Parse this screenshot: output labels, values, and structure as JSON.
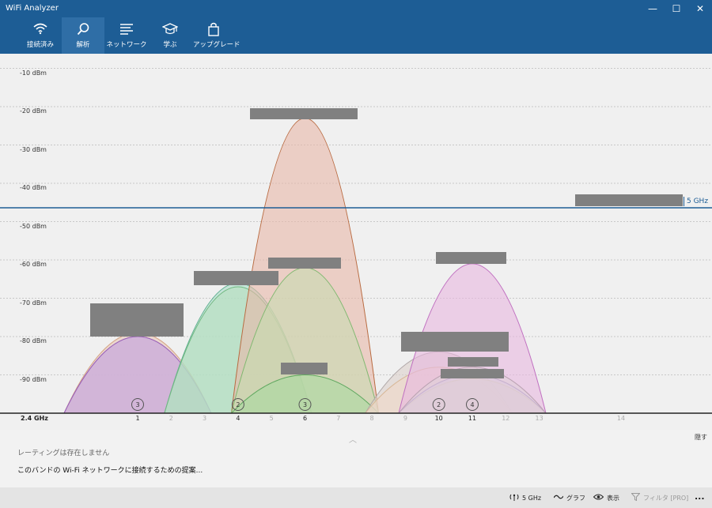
{
  "window": {
    "title": "WiFi Analyzer",
    "controls": {
      "minimize": "—",
      "maximize": "☐",
      "close": "✕"
    }
  },
  "tabs": [
    {
      "label": "接続済み",
      "icon": "wifi-icon",
      "active": false
    },
    {
      "label": "解析",
      "icon": "search-icon",
      "active": true
    },
    {
      "label": "ネットワーク",
      "icon": "list-icon",
      "active": false
    },
    {
      "label": "学ぶ",
      "icon": "graduation-cap-icon",
      "active": false
    },
    {
      "label": "アップグレード",
      "icon": "shopping-bag-icon",
      "active": false
    }
  ],
  "chart": {
    "y_ticks": [
      "-10 dBm",
      "-20 dBm",
      "-30 dBm",
      "-40 dBm",
      "-50 dBm",
      "-60 dBm",
      "-70 dBm",
      "-80 dBm",
      "-90 dBm"
    ],
    "band_label": "2.4 GHz",
    "x_ticks": [
      "1",
      "2",
      "3",
      "4",
      "5",
      "6",
      "7",
      "8",
      "9",
      "10",
      "11",
      "12",
      "13",
      "14"
    ],
    "highlighted_channels": [
      "1",
      "4",
      "6",
      "10",
      "11"
    ],
    "reference_line_label": "5 GHz",
    "reference_line_dbm": -45,
    "channel_badges": [
      {
        "channel": 1,
        "count": "3"
      },
      {
        "channel": 4,
        "count": "2"
      },
      {
        "channel": 6,
        "count": "3"
      },
      {
        "channel": 10,
        "count": "2"
      },
      {
        "channel": 11,
        "count": "4"
      }
    ]
  },
  "chart_data": {
    "type": "area",
    "xlabel": "",
    "ylabel": "",
    "ylim": [
      -100,
      -5
    ],
    "series": [
      {
        "channel": 1,
        "peak_dbm": -79,
        "fill": "#e8c8b8",
        "stroke": "#d4a080"
      },
      {
        "channel": 1,
        "peak_dbm": -80,
        "fill": "#d8c0e0",
        "stroke": "#b090c0"
      },
      {
        "channel": 1,
        "peak_dbm": -80,
        "fill": "#c8a8d8",
        "stroke": "#9a60b8"
      },
      {
        "channel": 4,
        "peak_dbm": -66,
        "fill": "#a8dcc8",
        "stroke": "#60b090"
      },
      {
        "channel": 4,
        "peak_dbm": -67,
        "fill": "#b8e0c0",
        "stroke": "#70b880"
      },
      {
        "channel": 6,
        "peak_dbm": -23,
        "fill": "#e8b8a8",
        "stroke": "#b86a40"
      },
      {
        "channel": 6,
        "peak_dbm": -62,
        "fill": "#c8dcb0",
        "stroke": "#80b870"
      },
      {
        "channel": 6,
        "peak_dbm": -90,
        "fill": "#a8d8a0",
        "stroke": "#60a860"
      },
      {
        "channel": 10,
        "peak_dbm": -84,
        "fill": "#dcd0cc",
        "stroke": "#b0a8a8"
      },
      {
        "channel": 10,
        "peak_dbm": -88,
        "fill": "#f0d8c8",
        "stroke": "#d8b898"
      },
      {
        "channel": 11,
        "peak_dbm": -61,
        "fill": "#e8b8e0",
        "stroke": "#c070c0"
      },
      {
        "channel": 11,
        "peak_dbm": -91,
        "fill": "#f0e0b8",
        "stroke": "#d8c080"
      },
      {
        "channel": 11,
        "peak_dbm": -90,
        "fill": "#d8c0e8",
        "stroke": "#a080c0"
      },
      {
        "channel": 11,
        "peak_dbm": -88,
        "fill": "#e0d0d8",
        "stroke": "#b8a0b0"
      }
    ],
    "grid": true
  },
  "panel": {
    "no_ratings": "レーティングは存在しません",
    "suggestion": "このバンドの Wi-Fi ネットワークに接続するための提案...",
    "hide": "隠す"
  },
  "statusbar": {
    "band": "5 GHz",
    "graph": "グラフ",
    "view": "表示",
    "filter": "フィルタ [PRO]",
    "more": "..."
  },
  "colors": {
    "header": "#1d5d95",
    "active_tab": "#2f6ea6",
    "reference_line": "#1d5d95",
    "redaction": "#808080"
  }
}
